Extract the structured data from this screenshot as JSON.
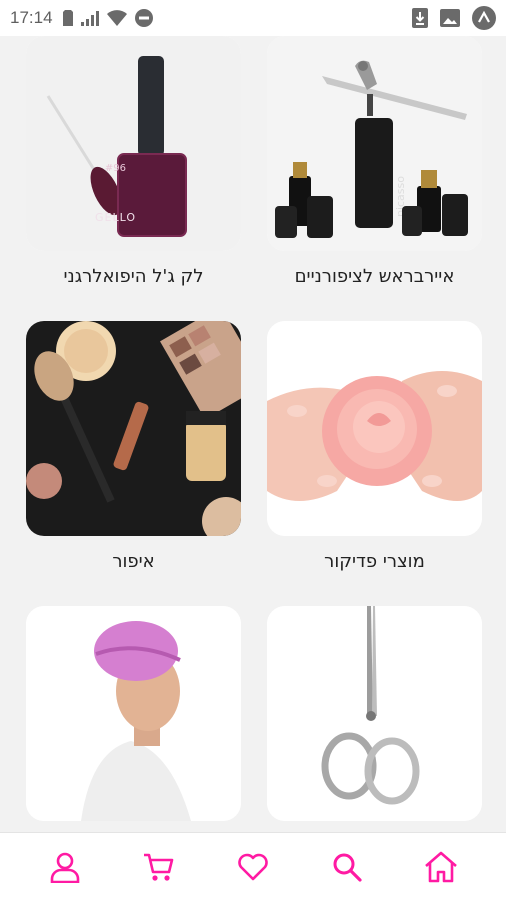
{
  "status_bar": {
    "time": "17:14",
    "icons_left": [
      "sim-card-icon",
      "signal-icon",
      "wifi-icon",
      "do-not-disturb-icon"
    ],
    "icons_right": [
      "download-icon",
      "image-icon",
      "app-icon"
    ]
  },
  "categories": [
    {
      "label": "איירבראש לציפורניים",
      "image": "airbrush-kit-image"
    },
    {
      "label": "לק ג'ל היפואלרגני",
      "image": "gel-polish-bottle-image"
    },
    {
      "label": "מוצרי פדיקור",
      "image": "hands-rose-image"
    },
    {
      "label": "איפור",
      "image": "makeup-brushes-image"
    },
    {
      "label": "",
      "image": "cuticle-scissors-image"
    },
    {
      "label": "",
      "image": "woman-hair-cap-image"
    }
  ],
  "bottom_nav": {
    "accent": "#ff1aa3",
    "items": [
      {
        "icon": "home-icon"
      },
      {
        "icon": "search-icon"
      },
      {
        "icon": "heart-icon"
      },
      {
        "icon": "cart-icon"
      },
      {
        "icon": "user-icon"
      }
    ]
  }
}
